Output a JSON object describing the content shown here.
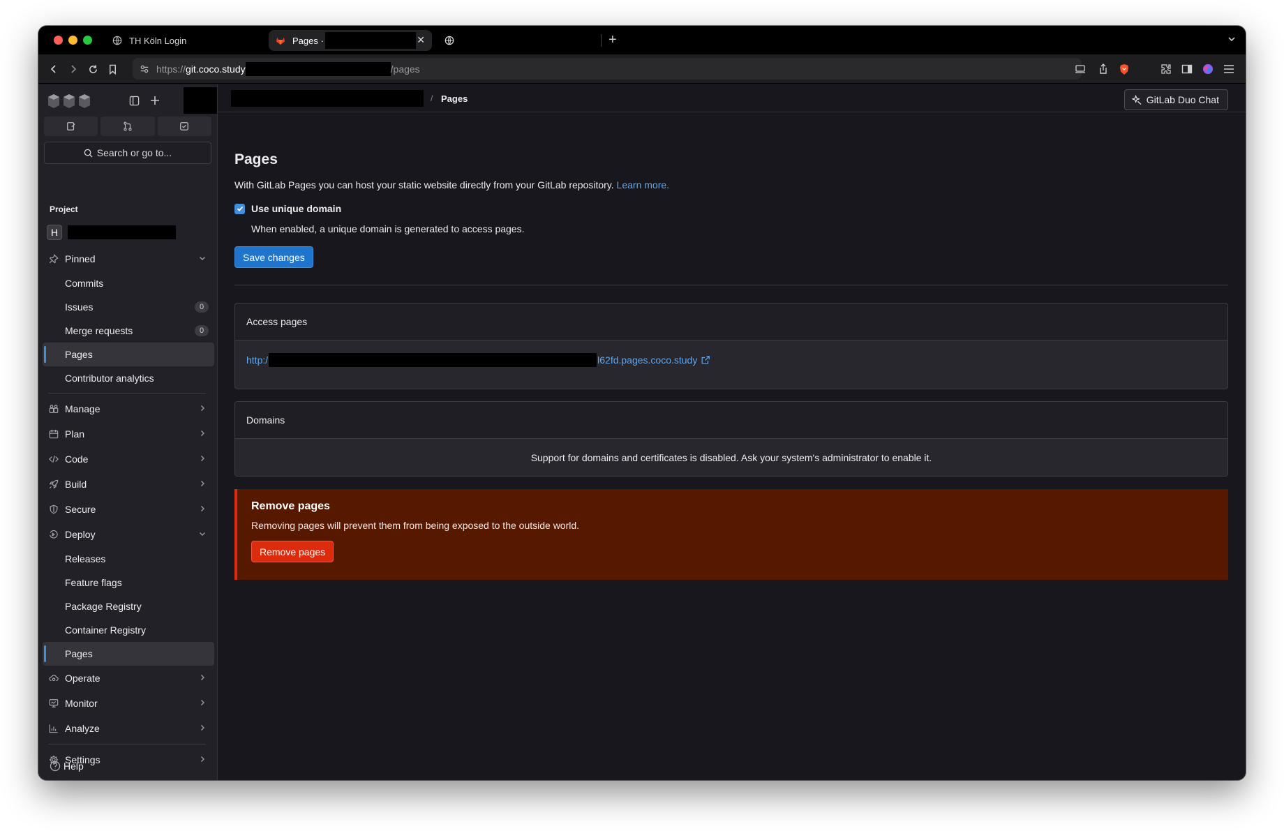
{
  "browser": {
    "tabs": [
      {
        "label": "TH Köln Login"
      },
      {
        "label": "Pages ·"
      }
    ],
    "url": {
      "prefix": "https://",
      "host": "git.coco.study",
      "suffix": "/pages"
    }
  },
  "sidebar": {
    "search_label": "Search or go to...",
    "section_label": "Project",
    "project_avatar": "H",
    "pinned_label": "Pinned",
    "pinned_items": [
      {
        "label": "Commits"
      },
      {
        "label": "Issues",
        "badge": "0"
      },
      {
        "label": "Merge requests",
        "badge": "0"
      },
      {
        "label": "Pages"
      },
      {
        "label": "Contributor analytics"
      }
    ],
    "groups_a": [
      {
        "label": "Manage"
      },
      {
        "label": "Plan"
      },
      {
        "label": "Code"
      },
      {
        "label": "Build"
      },
      {
        "label": "Secure"
      },
      {
        "label": "Deploy"
      }
    ],
    "deploy_items": [
      {
        "label": "Releases"
      },
      {
        "label": "Feature flags"
      },
      {
        "label": "Package Registry"
      },
      {
        "label": "Container Registry"
      },
      {
        "label": "Pages"
      }
    ],
    "groups_b": [
      {
        "label": "Operate"
      },
      {
        "label": "Monitor"
      },
      {
        "label": "Analyze"
      }
    ],
    "settings_label": "Settings",
    "help_label": "Help"
  },
  "header": {
    "breadcrumb_current": "Pages",
    "duo_label": "GitLab Duo Chat"
  },
  "main": {
    "title": "Pages",
    "intro": "With GitLab Pages you can host your static website directly from your GitLab repository.",
    "learn_more": "Learn more.",
    "checkbox_label": "Use unique domain",
    "checkbox_checked": true,
    "checkbox_help": "When enabled, a unique domain is generated to access pages.",
    "save_label": "Save changes",
    "access": {
      "title": "Access pages",
      "url_start": "http:/",
      "url_end": "l62fd.pages.coco.study"
    },
    "domains": {
      "title": "Domains",
      "message": "Support for domains and certificates is disabled. Ask your system's administrator to enable it."
    },
    "danger": {
      "title": "Remove pages",
      "text": "Removing pages will prevent them from being exposed to the outside world.",
      "button": "Remove pages"
    }
  },
  "colors": {
    "accent": "#428fdc",
    "link": "#63a6e9",
    "danger_bg": "#561900",
    "danger_button": "#dd2b0e"
  }
}
